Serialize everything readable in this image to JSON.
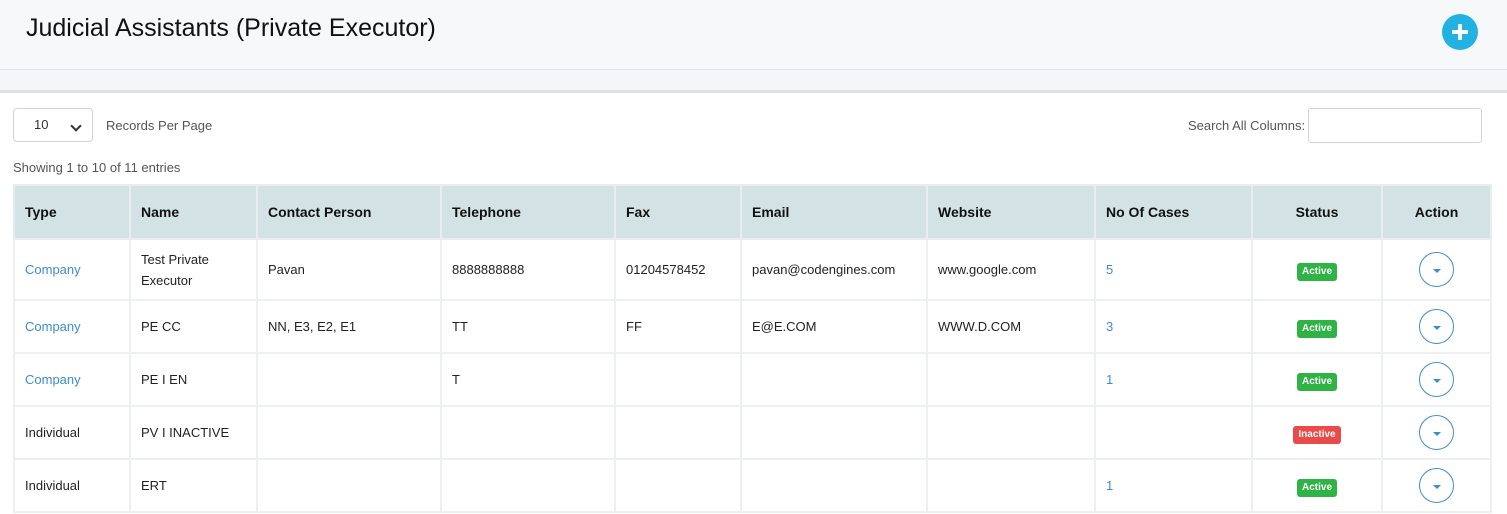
{
  "header": {
    "title": "Judicial Assistants (Private Executor)",
    "add_icon": "plus-circle-icon"
  },
  "controls": {
    "per_page_value": "10",
    "per_page_label": "Records Per Page",
    "search_label": "Search All Columns:",
    "search_value": "",
    "showing_text": "Showing 1 to 10 of 11 entries"
  },
  "colors": {
    "header_bg": "#d3e3e5",
    "link": "#3c8dd0",
    "active": "#2fb344",
    "inactive": "#e94b4b",
    "accent": "#22b1e0"
  },
  "table": {
    "columns": [
      "Type",
      "Name",
      "Contact Person",
      "Telephone",
      "Fax",
      "Email",
      "Website",
      "No Of Cases",
      "Status",
      "Action"
    ],
    "rows": [
      {
        "type": "Company",
        "name": "Test Private Executor",
        "contact_person": "Pavan",
        "telephone": "8888888888",
        "fax": "01204578452",
        "email": "pavan@codengines.com",
        "website": "www.google.com",
        "cases": "5",
        "status": "Active"
      },
      {
        "type": "Company",
        "name": "PE CC",
        "contact_person": "NN, E3, E2, E1",
        "telephone": "TT",
        "fax": "FF",
        "email": "E@E.COM",
        "website": "WWW.D.COM",
        "cases": "3",
        "status": "Active"
      },
      {
        "type": "Company",
        "name": "PE I EN",
        "contact_person": "",
        "telephone": "T",
        "fax": "",
        "email": "",
        "website": "",
        "cases": "1",
        "status": "Active"
      },
      {
        "type": "Individual",
        "name": "PV I INACTIVE",
        "contact_person": "",
        "telephone": "",
        "fax": "",
        "email": "",
        "website": "",
        "cases": "",
        "status": "Inactive"
      },
      {
        "type": "Individual",
        "name": "ERT",
        "contact_person": "",
        "telephone": "",
        "fax": "",
        "email": "",
        "website": "",
        "cases": "1",
        "status": "Active"
      }
    ]
  }
}
